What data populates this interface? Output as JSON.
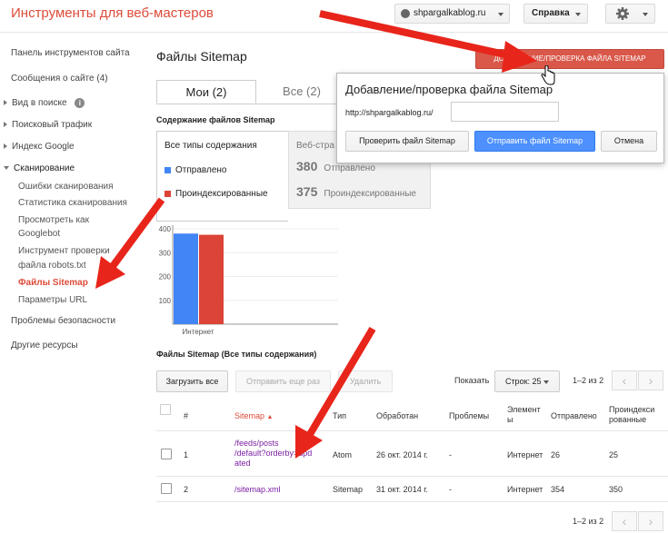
{
  "header": {
    "title": "Инструменты для веб-мастеров",
    "site": "shpargalkablog.ru",
    "help": "Справка"
  },
  "sidebar": {
    "items": [
      {
        "label": "Панель инструментов сайта"
      },
      {
        "label": "Сообщения о сайте (4)"
      },
      {
        "label": "Вид в поиске"
      },
      {
        "label": "Поисковый трафик"
      },
      {
        "label": "Индекс Google"
      },
      {
        "label": "Сканирование"
      },
      {
        "label": "Ошибки сканирования"
      },
      {
        "label": "Статистика сканирования"
      },
      {
        "label": "Просмотреть как"
      },
      {
        "label": "Googlebot"
      },
      {
        "label": "Инструмент проверки"
      },
      {
        "label": "файла robots.txt"
      },
      {
        "label": "Файлы Sitemap"
      },
      {
        "label": "Параметры URL"
      },
      {
        "label": "Проблемы безопасности"
      },
      {
        "label": "Другие ресурсы"
      }
    ]
  },
  "main": {
    "title": "Файлы Sitemap",
    "add_button": "ДОБАВЛЕНИЕ/ПРОВЕРКА ФАЙЛА SITEMAP",
    "tabs": [
      {
        "label": "Мои (2)"
      },
      {
        "label": "Все (2)"
      }
    ],
    "content_label": "Содержание файлов Sitemap",
    "types_title": "Все типы содержания",
    "legend_sent": "Отправлено",
    "legend_indexed": "Проиндексированные",
    "web_title": "Веб-стра",
    "web_sent_value": "380",
    "web_sent_label": "Отправлено",
    "web_indexed_value": "375",
    "web_indexed_label": "Проиндексированные",
    "colors": {
      "sent": "#4285f4",
      "indexed": "#db4437",
      "accent": "#dd4b39"
    }
  },
  "popup": {
    "title": "Добавление/проверка файла Sitemap",
    "prefix": "http://shpargalkablog.ru/",
    "input_value": "",
    "check_button": "Проверить файл Sitemap",
    "submit_button": "Отправить файл Sitemap",
    "cancel_button": "Отмена"
  },
  "chart_data": {
    "type": "bar",
    "categories": [
      "Интернет"
    ],
    "series": [
      {
        "name": "Отправлено",
        "values": [
          380
        ]
      },
      {
        "name": "Проиндексированные",
        "values": [
          375
        ]
      }
    ],
    "ytick_labels": [
      "100",
      "200",
      "300",
      "400"
    ],
    "ylim": [
      0,
      400
    ]
  },
  "files": {
    "label": "Файлы Sitemap (Все типы содержания)",
    "upload_button": "Загрузить все",
    "resend_button": "Отправить еще раз",
    "delete_button": "Удалить",
    "show_label": "Показать",
    "rows_select": "Строк: 25",
    "pager": "1–2 из 2",
    "columns": [
      "#",
      "Sitemap",
      "Тип",
      "Обработан",
      "Проблемы",
      "Элементы",
      "Отправлено",
      "Проиндексированные"
    ],
    "col_items": [
      "Элемент",
      "ы"
    ],
    "col_indexed": [
      "Проиндекси",
      "рованные"
    ],
    "rows": [
      {
        "num": "1",
        "path": [
          "/feeds/posts",
          "/default?orderby=upd",
          "ated"
        ],
        "type": "Atom",
        "processed": "26 окт. 2014 г.",
        "issues": "-",
        "items": "Интернет",
        "sent": "26",
        "indexed": "25"
      },
      {
        "num": "2",
        "path": [
          "/sitemap.xml"
        ],
        "type": "Sitemap",
        "processed": "31 окт. 2014 г.",
        "issues": "-",
        "items": "Интернет",
        "sent": "354",
        "indexed": "350"
      }
    ]
  }
}
